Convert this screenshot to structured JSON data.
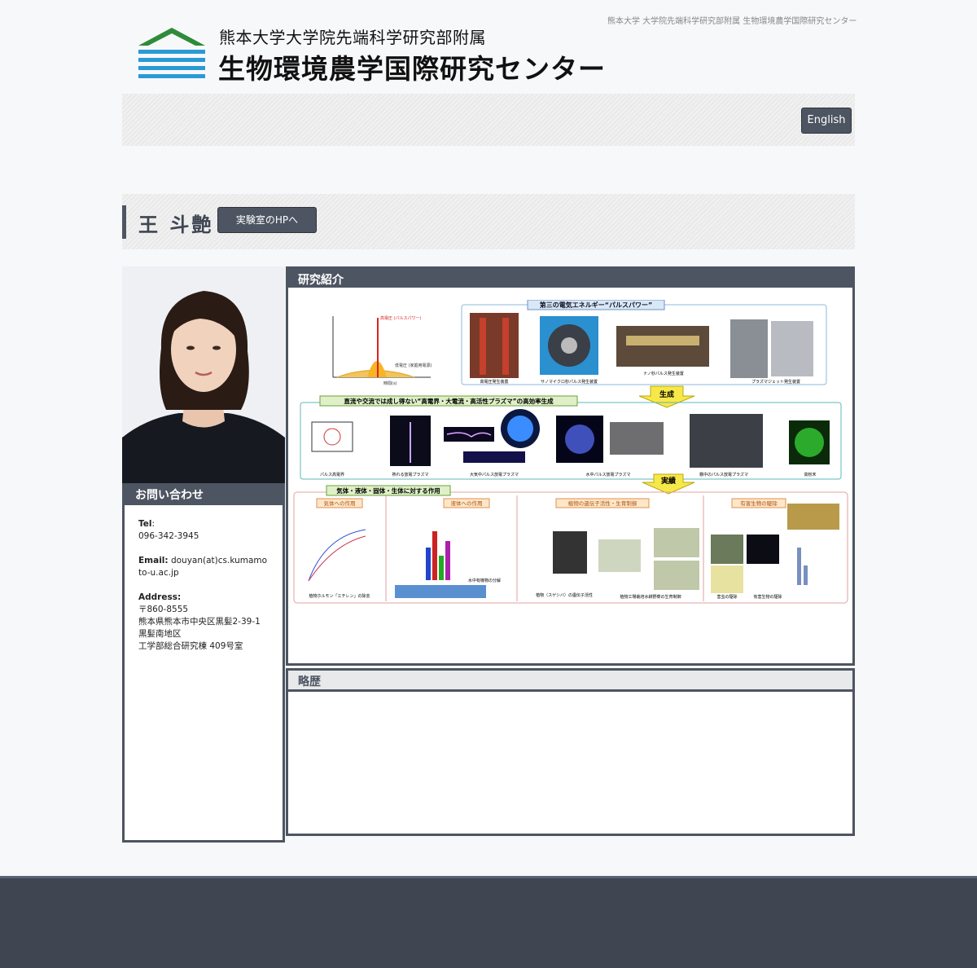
{
  "header": {
    "tagline": "熊本大学 大学院先端科学研究部附属 生物環境農学国際研究センター",
    "logo_sub": "熊本大学大学院先端科学研究部附属",
    "logo_main": "生物環境農学国際研究センター",
    "english_button": "English"
  },
  "profile": {
    "name": "王 斗艶",
    "lab_button": "実験室のHPへ"
  },
  "contact": {
    "heading": "お問い合わせ",
    "tel_label": "Tel",
    "tel": "096-342-3945",
    "email_label": "Email",
    "email": "douyan(at)cs.kumamoto-u.ac.jp",
    "address_label": "Address",
    "address_lines": [
      "〒860-8555",
      "熊本県熊本市中央区黒髪2-39-1",
      "黒髪南地区",
      "工学部総合研究棟 409号室"
    ]
  },
  "research": {
    "heading": "研究紹介",
    "diagram": {
      "top_title": "第三の電気エネルギー“パルスパワー”",
      "top_captions": [
        "高電圧発生装置",
        "サノマイクロ秒パルス発生装置",
        "ナノ秒パルス発生装置",
        "プラズマジェット発生装置"
      ],
      "graph_labels": [
        "高電圧 (パルスパワー)",
        "低電圧 (家庭用電源)",
        "時間(s)"
      ],
      "arrow_generate": "生成",
      "mid_title": "直流や交流では成し得ない“高電界・大電流・高活性プラズマ”の高効率生成",
      "mid_captions": [
        "パルス高電界",
        "熱れる放電プラズマ",
        "大気中パルス放電プラズマ",
        "水中パルス放電プラズマ",
        "霧中のパルス放電プラズマ",
        "高粉末"
      ],
      "arrow_result": "実績",
      "bottom_title": "気体・液体・固体・生体に対する作用",
      "bottom_boxes": [
        "気体への作用",
        "液体への作用",
        "植物の遺伝子活性・生育制御",
        "有害生物の駆除"
      ],
      "bottom_captions": [
        "植物ホルモン「エチレン」の除去",
        "水中有機物の分解",
        "植物（スゲシバ）の遺伝子活性",
        "植物工場栽培水耕野菜の生育制御",
        "害虫の駆除",
        "有害生物の駆除"
      ]
    }
  },
  "career": {
    "heading": "略歴"
  },
  "colors": {
    "dark": "#4d5562",
    "accent_green": "#2e8b3a",
    "accent_blue": "#2a9ad6",
    "arrow_yellow": "#f7e84a"
  }
}
